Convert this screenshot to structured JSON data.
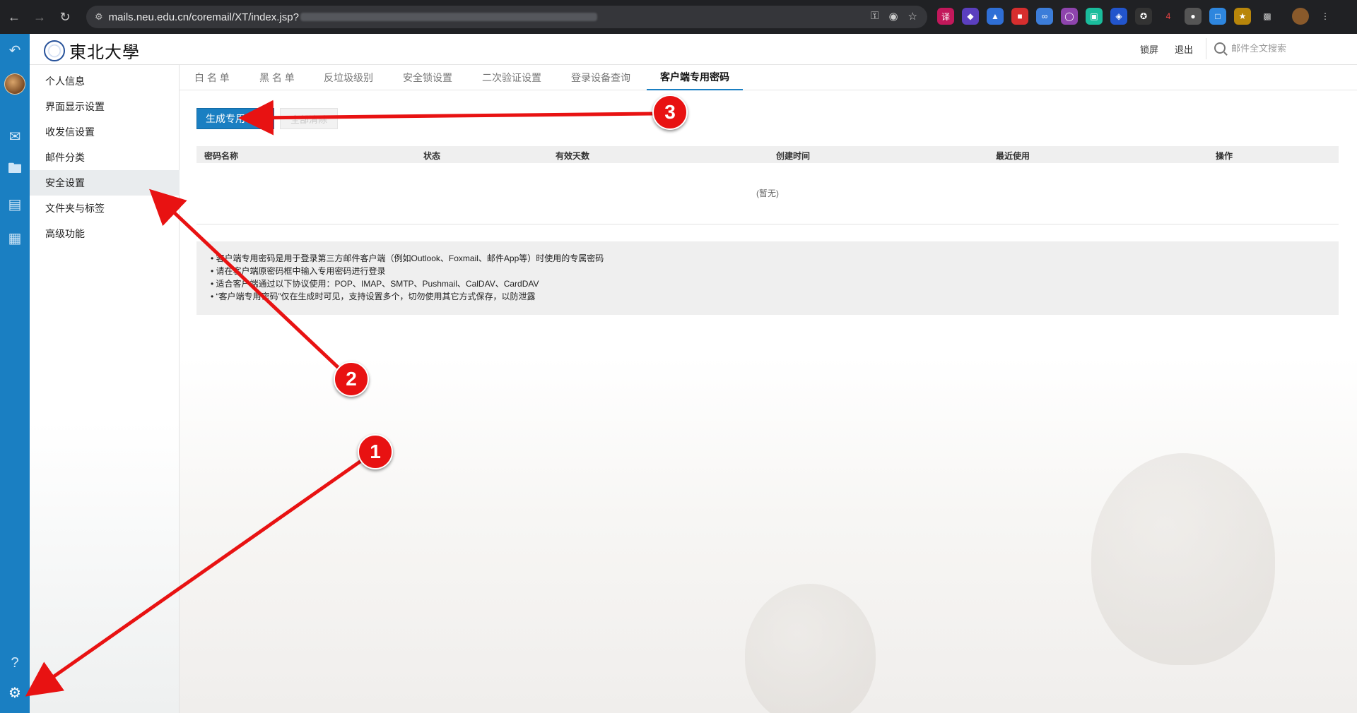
{
  "browser": {
    "url_visible": "mails.neu.edu.cn/coremail/XT/index.jsp?"
  },
  "header": {
    "logo_text": "東北大學",
    "lock_screen": "锁屏",
    "logout": "退出",
    "search_placeholder": "邮件全文搜索"
  },
  "settings_nav": {
    "items": [
      {
        "label": "个人信息"
      },
      {
        "label": "界面显示设置"
      },
      {
        "label": "收发信设置"
      },
      {
        "label": "邮件分类"
      },
      {
        "label": "安全设置",
        "active": true
      },
      {
        "label": "文件夹与标签"
      },
      {
        "label": "高级功能"
      }
    ]
  },
  "tabs": [
    {
      "label": "白 名 单"
    },
    {
      "label": "黑 名 单"
    },
    {
      "label": "反垃圾级别"
    },
    {
      "label": "安全锁设置"
    },
    {
      "label": "二次验证设置"
    },
    {
      "label": "登录设备查询"
    },
    {
      "label": "客户端专用密码",
      "active": true
    }
  ],
  "actions": {
    "generate_label": "生成专用密码",
    "clear_all_label": "全部清除"
  },
  "table": {
    "columns": [
      "密码名称",
      "状态",
      "有效天数",
      "创建时间",
      "最近使用",
      "操作"
    ],
    "empty_text": "(暂无)"
  },
  "info_lines": [
    "• 客户端专用密码是用于登录第三方邮件客户端（例如Outlook、Foxmail、邮件App等）时使用的专属密码",
    "• 请在客户端原密码框中输入专用密码进行登录",
    "• 适合客户端通过以下协议使用：POP、IMAP、SMTP、Pushmail、CalDAV、CardDAV",
    "• “客户端专用密码”仅在生成时可见，支持设置多个，切勿使用其它方式保存，以防泄露"
  ],
  "annotations": [
    "1",
    "2",
    "3"
  ],
  "colors": {
    "accent": "#1a7fc2",
    "annotation": "#e81212"
  }
}
